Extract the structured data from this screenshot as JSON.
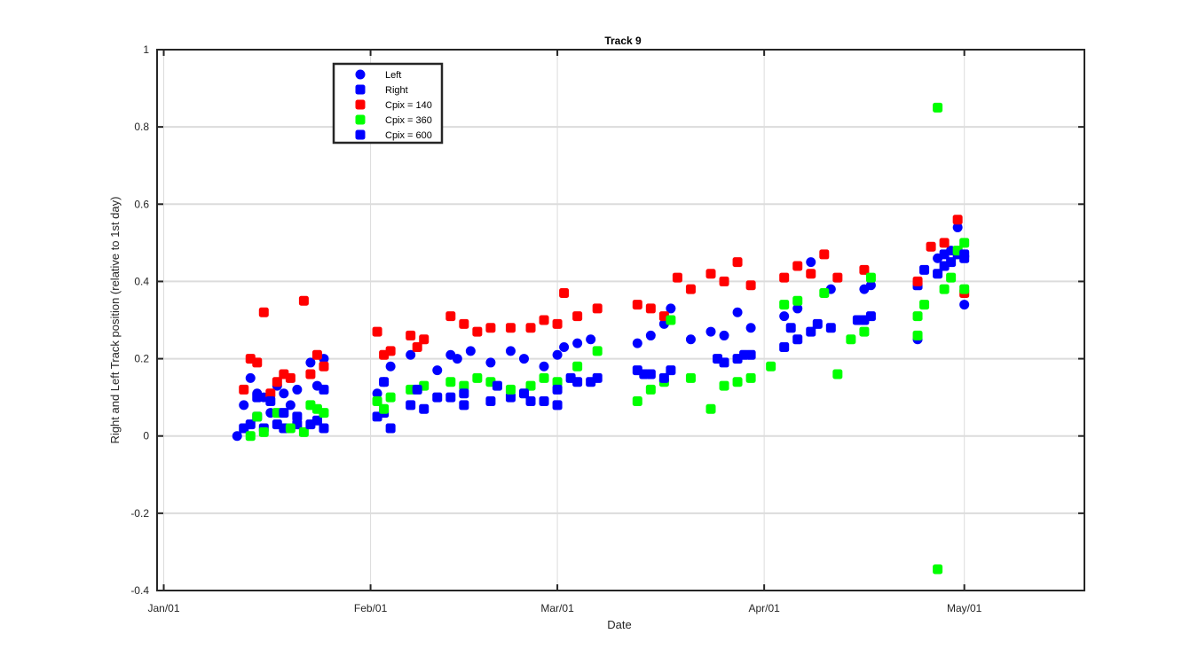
{
  "chart_data": {
    "type": "scatter",
    "title": "Track 9",
    "xlabel": "Date",
    "ylabel": "Right and Left Track position (relative to 1st day)",
    "x_type": "date",
    "xlim": [
      "Dec-31",
      "May-19"
    ],
    "ylim": [
      -0.4,
      1.0
    ],
    "x_ticks": [
      {
        "label": "Jan/01",
        "date": "Jan-01"
      },
      {
        "label": "Feb/01",
        "date": "Feb-01"
      },
      {
        "label": "Mar/01",
        "date": "Mar-01"
      },
      {
        "label": "Apr/01",
        "date": "Apr-01"
      },
      {
        "label": "May/01",
        "date": "May-01"
      }
    ],
    "y_ticks": [
      {
        "label": "1",
        "value": 1.0
      },
      {
        "label": "0.8",
        "value": 0.8
      },
      {
        "label": "0.6",
        "value": 0.6
      },
      {
        "label": "0.4",
        "value": 0.4
      },
      {
        "label": "0.2",
        "value": 0.2
      },
      {
        "label": "0",
        "value": 0.0
      },
      {
        "label": "-0.2",
        "value": -0.2
      },
      {
        "label": "-0.4",
        "value": -0.4
      }
    ],
    "grid": true,
    "legend_position": "top-left",
    "series": [
      {
        "name": "Left",
        "marker": "circle",
        "color": "#0000ff",
        "points": [
          {
            "x": "Jan-12",
            "y": 0.0
          },
          {
            "x": "Jan-13",
            "y": 0.08
          },
          {
            "x": "Jan-14",
            "y": 0.15
          },
          {
            "x": "Jan-15",
            "y": 0.11
          },
          {
            "x": "Jan-16",
            "y": 0.1
          },
          {
            "x": "Jan-17",
            "y": 0.06
          },
          {
            "x": "Jan-18",
            "y": 0.13
          },
          {
            "x": "Jan-19",
            "y": 0.11
          },
          {
            "x": "Jan-20",
            "y": 0.08
          },
          {
            "x": "Jan-21",
            "y": 0.12
          },
          {
            "x": "Jan-23",
            "y": 0.19
          },
          {
            "x": "Jan-24",
            "y": 0.13
          },
          {
            "x": "Jan-25",
            "y": 0.2
          },
          {
            "x": "Feb-02",
            "y": 0.11
          },
          {
            "x": "Feb-03",
            "y": 0.14
          },
          {
            "x": "Feb-04",
            "y": 0.18
          },
          {
            "x": "Feb-07",
            "y": 0.21
          },
          {
            "x": "Feb-11",
            "y": 0.17
          },
          {
            "x": "Feb-13",
            "y": 0.21
          },
          {
            "x": "Feb-14",
            "y": 0.2
          },
          {
            "x": "Feb-16",
            "y": 0.22
          },
          {
            "x": "Feb-19",
            "y": 0.19
          },
          {
            "x": "Feb-22",
            "y": 0.22
          },
          {
            "x": "Feb-24",
            "y": 0.2
          },
          {
            "x": "Feb-27",
            "y": 0.18
          },
          {
            "x": "Mar-01",
            "y": 0.21
          },
          {
            "x": "Mar-02",
            "y": 0.23
          },
          {
            "x": "Mar-04",
            "y": 0.24
          },
          {
            "x": "Mar-06",
            "y": 0.25
          },
          {
            "x": "Mar-13",
            "y": 0.24
          },
          {
            "x": "Mar-15",
            "y": 0.26
          },
          {
            "x": "Mar-17",
            "y": 0.29
          },
          {
            "x": "Mar-18",
            "y": 0.33
          },
          {
            "x": "Mar-21",
            "y": 0.25
          },
          {
            "x": "Mar-24",
            "y": 0.27
          },
          {
            "x": "Mar-26",
            "y": 0.26
          },
          {
            "x": "Mar-28",
            "y": 0.32
          },
          {
            "x": "Mar-30",
            "y": 0.28
          },
          {
            "x": "Apr-04",
            "y": 0.31
          },
          {
            "x": "Apr-06",
            "y": 0.33
          },
          {
            "x": "Apr-08",
            "y": 0.45
          },
          {
            "x": "Apr-11",
            "y": 0.38
          },
          {
            "x": "Apr-16",
            "y": 0.38
          },
          {
            "x": "Apr-17",
            "y": 0.39
          },
          {
            "x": "Apr-24",
            "y": 0.25
          },
          {
            "x": "Apr-27",
            "y": 0.46
          },
          {
            "x": "Apr-29",
            "y": 0.48
          },
          {
            "x": "Apr-30",
            "y": 0.54
          },
          {
            "x": "May-01",
            "y": 0.34
          }
        ]
      },
      {
        "name": "Right",
        "marker": "square",
        "color": "#0000ff",
        "points": [
          {
            "x": "Jan-13",
            "y": 0.02
          },
          {
            "x": "Jan-14",
            "y": 0.03
          },
          {
            "x": "Jan-15",
            "y": 0.05
          },
          {
            "x": "Jan-16",
            "y": 0.02
          },
          {
            "x": "Jan-18",
            "y": 0.03
          },
          {
            "x": "Jan-19",
            "y": 0.02
          },
          {
            "x": "Jan-21",
            "y": 0.03
          },
          {
            "x": "Jan-24",
            "y": 0.04
          },
          {
            "x": "Jan-25",
            "y": 0.02
          },
          {
            "x": "Feb-02",
            "y": 0.05
          },
          {
            "x": "Feb-03",
            "y": 0.06
          },
          {
            "x": "Feb-04",
            "y": 0.02
          },
          {
            "x": "Feb-07",
            "y": 0.08
          },
          {
            "x": "Feb-09",
            "y": 0.07
          },
          {
            "x": "Feb-13",
            "y": 0.1
          },
          {
            "x": "Feb-15",
            "y": 0.08
          },
          {
            "x": "Feb-19",
            "y": 0.09
          },
          {
            "x": "Feb-22",
            "y": 0.1
          },
          {
            "x": "Feb-25",
            "y": 0.09
          },
          {
            "x": "Feb-27",
            "y": 0.09
          },
          {
            "x": "Mar-01",
            "y": 0.08
          },
          {
            "x": "Mar-04",
            "y": 0.14
          },
          {
            "x": "Mar-07",
            "y": 0.15
          },
          {
            "x": "Mar-13",
            "y": 0.17
          },
          {
            "x": "Mar-15",
            "y": 0.16
          },
          {
            "x": "Mar-18",
            "y": 0.17
          },
          {
            "x": "Mar-26",
            "y": 0.19
          },
          {
            "x": "Mar-28",
            "y": 0.2
          },
          {
            "x": "Mar-30",
            "y": 0.21
          },
          {
            "x": "Apr-04",
            "y": 0.23
          },
          {
            "x": "Apr-06",
            "y": 0.25
          },
          {
            "x": "Apr-08",
            "y": 0.27
          },
          {
            "x": "Apr-11",
            "y": 0.28
          },
          {
            "x": "Apr-16",
            "y": 0.3
          },
          {
            "x": "Apr-17",
            "y": 0.31
          },
          {
            "x": "Apr-24",
            "y": 0.39
          },
          {
            "x": "Apr-27",
            "y": 0.42
          },
          {
            "x": "Apr-28",
            "y": 0.47
          },
          {
            "x": "Apr-29",
            "y": 0.45
          },
          {
            "x": "Apr-30",
            "y": 0.47
          },
          {
            "x": "May-01",
            "y": 0.46
          }
        ]
      },
      {
        "name": "Cpix = 140",
        "marker": "square",
        "color": "#ff0000",
        "points": [
          {
            "x": "Jan-13",
            "y": 0.12
          },
          {
            "x": "Jan-14",
            "y": 0.2
          },
          {
            "x": "Jan-15",
            "y": 0.19
          },
          {
            "x": "Jan-16",
            "y": 0.32
          },
          {
            "x": "Jan-17",
            "y": 0.11
          },
          {
            "x": "Jan-18",
            "y": 0.14
          },
          {
            "x": "Jan-19",
            "y": 0.16
          },
          {
            "x": "Jan-20",
            "y": 0.15
          },
          {
            "x": "Jan-22",
            "y": 0.35
          },
          {
            "x": "Jan-23",
            "y": 0.16
          },
          {
            "x": "Jan-24",
            "y": 0.21
          },
          {
            "x": "Jan-25",
            "y": 0.18
          },
          {
            "x": "Feb-02",
            "y": 0.27
          },
          {
            "x": "Feb-03",
            "y": 0.21
          },
          {
            "x": "Feb-04",
            "y": 0.22
          },
          {
            "x": "Feb-07",
            "y": 0.26
          },
          {
            "x": "Feb-08",
            "y": 0.23
          },
          {
            "x": "Feb-09",
            "y": 0.25
          },
          {
            "x": "Feb-13",
            "y": 0.31
          },
          {
            "x": "Feb-15",
            "y": 0.29
          },
          {
            "x": "Feb-17",
            "y": 0.27
          },
          {
            "x": "Feb-19",
            "y": 0.28
          },
          {
            "x": "Feb-22",
            "y": 0.28
          },
          {
            "x": "Feb-25",
            "y": 0.28
          },
          {
            "x": "Feb-27",
            "y": 0.3
          },
          {
            "x": "Mar-01",
            "y": 0.29
          },
          {
            "x": "Mar-02",
            "y": 0.37
          },
          {
            "x": "Mar-04",
            "y": 0.31
          },
          {
            "x": "Mar-07",
            "y": 0.33
          },
          {
            "x": "Mar-13",
            "y": 0.34
          },
          {
            "x": "Mar-15",
            "y": 0.33
          },
          {
            "x": "Mar-17",
            "y": 0.31
          },
          {
            "x": "Mar-19",
            "y": 0.41
          },
          {
            "x": "Mar-21",
            "y": 0.38
          },
          {
            "x": "Mar-24",
            "y": 0.42
          },
          {
            "x": "Mar-26",
            "y": 0.4
          },
          {
            "x": "Mar-28",
            "y": 0.45
          },
          {
            "x": "Mar-30",
            "y": 0.39
          },
          {
            "x": "Apr-04",
            "y": 0.41
          },
          {
            "x": "Apr-06",
            "y": 0.44
          },
          {
            "x": "Apr-08",
            "y": 0.42
          },
          {
            "x": "Apr-10",
            "y": 0.47
          },
          {
            "x": "Apr-12",
            "y": 0.41
          },
          {
            "x": "Apr-16",
            "y": 0.43
          },
          {
            "x": "Apr-24",
            "y": 0.4
          },
          {
            "x": "Apr-26",
            "y": 0.49
          },
          {
            "x": "Apr-28",
            "y": 0.5
          },
          {
            "x": "Apr-30",
            "y": 0.56
          },
          {
            "x": "May-01",
            "y": 0.37
          }
        ]
      },
      {
        "name": "Cpix = 360",
        "marker": "square",
        "color": "#00ff00",
        "points": [
          {
            "x": "Jan-14",
            "y": 0.0
          },
          {
            "x": "Jan-15",
            "y": 0.05
          },
          {
            "x": "Jan-16",
            "y": 0.01
          },
          {
            "x": "Jan-18",
            "y": 0.06
          },
          {
            "x": "Jan-20",
            "y": 0.02
          },
          {
            "x": "Jan-22",
            "y": 0.01
          },
          {
            "x": "Jan-23",
            "y": 0.08
          },
          {
            "x": "Jan-24",
            "y": 0.07
          },
          {
            "x": "Jan-25",
            "y": 0.06
          },
          {
            "x": "Feb-02",
            "y": 0.09
          },
          {
            "x": "Feb-03",
            "y": 0.07
          },
          {
            "x": "Feb-04",
            "y": 0.1
          },
          {
            "x": "Feb-07",
            "y": 0.12
          },
          {
            "x": "Feb-09",
            "y": 0.13
          },
          {
            "x": "Feb-13",
            "y": 0.14
          },
          {
            "x": "Feb-15",
            "y": 0.13
          },
          {
            "x": "Feb-17",
            "y": 0.15
          },
          {
            "x": "Feb-19",
            "y": 0.14
          },
          {
            "x": "Feb-22",
            "y": 0.12
          },
          {
            "x": "Feb-25",
            "y": 0.13
          },
          {
            "x": "Feb-27",
            "y": 0.15
          },
          {
            "x": "Mar-01",
            "y": 0.14
          },
          {
            "x": "Mar-04",
            "y": 0.18
          },
          {
            "x": "Mar-07",
            "y": 0.22
          },
          {
            "x": "Mar-13",
            "y": 0.09
          },
          {
            "x": "Mar-15",
            "y": 0.12
          },
          {
            "x": "Mar-17",
            "y": 0.14
          },
          {
            "x": "Mar-18",
            "y": 0.3
          },
          {
            "x": "Mar-21",
            "y": 0.15
          },
          {
            "x": "Mar-24",
            "y": 0.07
          },
          {
            "x": "Mar-26",
            "y": 0.13
          },
          {
            "x": "Mar-28",
            "y": 0.14
          },
          {
            "x": "Mar-30",
            "y": 0.15
          },
          {
            "x": "Apr-02",
            "y": 0.18
          },
          {
            "x": "Apr-04",
            "y": 0.34
          },
          {
            "x": "Apr-06",
            "y": 0.35
          },
          {
            "x": "Apr-10",
            "y": 0.37
          },
          {
            "x": "Apr-12",
            "y": 0.16
          },
          {
            "x": "Apr-14",
            "y": 0.25
          },
          {
            "x": "Apr-16",
            "y": 0.27
          },
          {
            "x": "Apr-17",
            "y": 0.41
          },
          {
            "x": "Apr-24",
            "y": 0.26
          },
          {
            "x": "Apr-24",
            "y": 0.31
          },
          {
            "x": "Apr-25",
            "y": 0.34
          },
          {
            "x": "Apr-27",
            "y": 0.85
          },
          {
            "x": "Apr-27",
            "y": -0.345
          },
          {
            "x": "Apr-28",
            "y": 0.38
          },
          {
            "x": "Apr-29",
            "y": 0.41
          },
          {
            "x": "Apr-30",
            "y": 0.48
          },
          {
            "x": "May-01",
            "y": 0.5
          },
          {
            "x": "May-01",
            "y": 0.38
          }
        ]
      },
      {
        "name": "Cpix = 600",
        "marker": "square",
        "color": "#0000ff",
        "points": [
          {
            "x": "Jan-15",
            "y": 0.1
          },
          {
            "x": "Jan-17",
            "y": 0.09
          },
          {
            "x": "Jan-19",
            "y": 0.06
          },
          {
            "x": "Jan-21",
            "y": 0.05
          },
          {
            "x": "Jan-23",
            "y": 0.03
          },
          {
            "x": "Jan-25",
            "y": 0.12
          },
          {
            "x": "Feb-03",
            "y": 0.14
          },
          {
            "x": "Feb-08",
            "y": 0.12
          },
          {
            "x": "Feb-11",
            "y": 0.1
          },
          {
            "x": "Feb-15",
            "y": 0.11
          },
          {
            "x": "Feb-20",
            "y": 0.13
          },
          {
            "x": "Feb-24",
            "y": 0.11
          },
          {
            "x": "Mar-01",
            "y": 0.12
          },
          {
            "x": "Mar-03",
            "y": 0.15
          },
          {
            "x": "Mar-06",
            "y": 0.14
          },
          {
            "x": "Mar-14",
            "y": 0.16
          },
          {
            "x": "Mar-17",
            "y": 0.15
          },
          {
            "x": "Mar-25",
            "y": 0.2
          },
          {
            "x": "Mar-29",
            "y": 0.21
          },
          {
            "x": "Apr-05",
            "y": 0.28
          },
          {
            "x": "Apr-09",
            "y": 0.29
          },
          {
            "x": "Apr-15",
            "y": 0.3
          },
          {
            "x": "Apr-25",
            "y": 0.43
          },
          {
            "x": "Apr-28",
            "y": 0.44
          },
          {
            "x": "May-01",
            "y": 0.47
          }
        ]
      }
    ]
  }
}
